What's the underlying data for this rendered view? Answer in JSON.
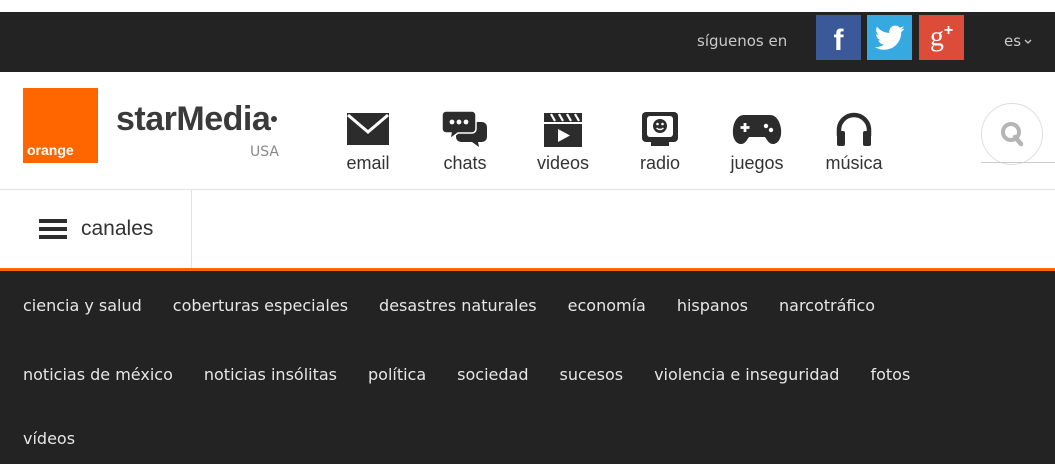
{
  "topbar": {
    "follow_label": "síguenos en",
    "social": [
      {
        "name": "facebook",
        "icon": "facebook-icon",
        "color": "#3b5998"
      },
      {
        "name": "twitter",
        "icon": "twitter-icon",
        "color": "#36a9e1"
      },
      {
        "name": "google-plus",
        "icon": "google-plus-icon",
        "color": "#dd4b39"
      }
    ],
    "language": "es",
    "background": "#232323"
  },
  "header": {
    "partner_logo_text": "orange",
    "partner_color": "#ff6600",
    "site_logo_text": "starMedia",
    "region": "USA",
    "services": [
      {
        "label": "email",
        "icon": "envelope-icon"
      },
      {
        "label": "chats",
        "icon": "chat-bubbles-icon"
      },
      {
        "label": "videos",
        "icon": "clapperboard-icon"
      },
      {
        "label": "radio",
        "icon": "radio-icon"
      },
      {
        "label": "juegos",
        "icon": "gamepad-icon"
      },
      {
        "label": "música",
        "icon": "headphones-icon"
      }
    ],
    "search_icon": "search-icon"
  },
  "subbar": {
    "menu_label": "canales",
    "menu_icon": "hamburger-icon"
  },
  "categories": {
    "row1": [
      "ciencia y salud",
      "coberturas especiales",
      "desastres naturales",
      "economía",
      "hispanos",
      "narcotráfico"
    ],
    "row2": [
      "noticias de méxico",
      "noticias insólitas",
      "política",
      "sociedad",
      "sucesos",
      "violencia e inseguridad",
      "fotos"
    ],
    "row3": [
      "vídeos"
    ]
  }
}
